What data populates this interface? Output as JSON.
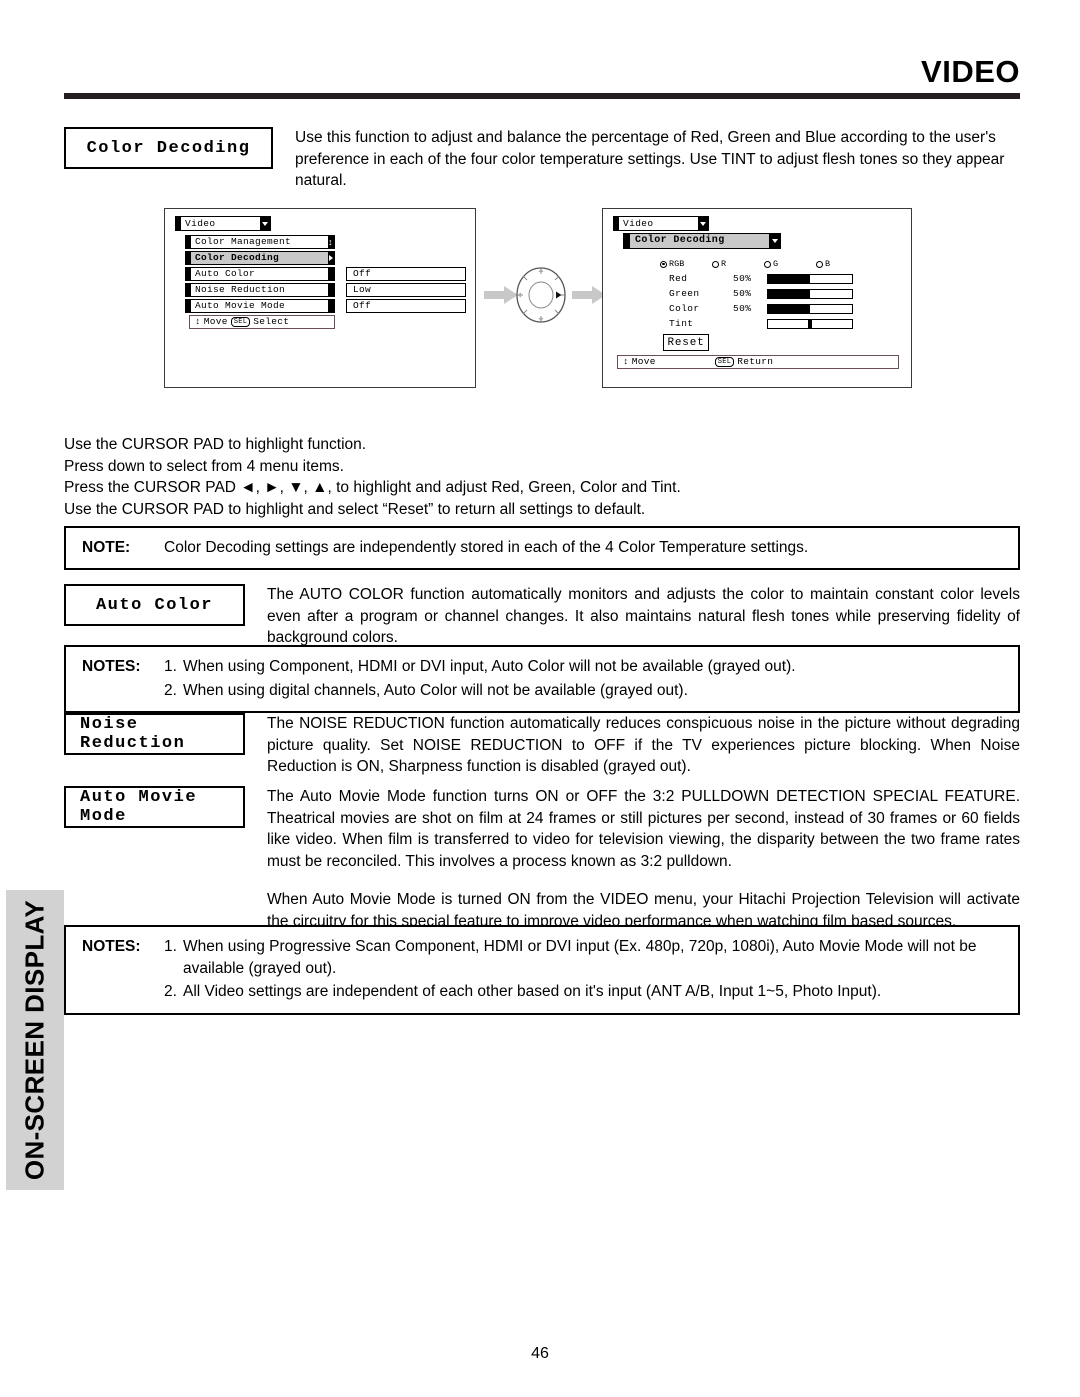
{
  "header": {
    "title": "VIDEO"
  },
  "side_tab": {
    "label": "ON-SCREEN DISPLAY"
  },
  "page_number": "46",
  "features": {
    "color_decoding": {
      "label": "Color Decoding",
      "text": "Use this function to adjust and balance the percentage of Red, Green and Blue according to the user's preference in each of the four color temperature settings.  Use TINT to adjust flesh tones so they appear natural."
    },
    "auto_color": {
      "label": "Auto Color",
      "text": "The AUTO COLOR function automatically monitors and adjusts the color to maintain constant color levels even after a program or channel changes. It also maintains natural flesh tones while preserving fidelity of background colors."
    },
    "noise_reduction": {
      "label": "Noise Reduction",
      "text": "The NOISE REDUCTION function automatically reduces conspicuous noise in the picture without degrading picture quality.  Set NOISE REDUCTION to OFF if the TV experiences picture blocking.  When Noise Reduction is ON, Sharpness function is disabled (grayed out)."
    },
    "auto_movie_mode": {
      "label": "Auto Movie Mode",
      "text_p1": "The Auto Movie Mode function turns ON or OFF the 3:2 PULLDOWN DETECTION SPECIAL FEATURE. Theatrical movies are shot on film at 24 frames or still pictures per second, instead of 30 frames or 60 fields like video.  When film is transferred to video for television viewing, the disparity between the two frame rates must be reconciled.  This involves a process known as 3:2 pulldown.",
      "text_p2": "When Auto Movie Mode is turned ON from the VIDEO menu, your Hitachi Projection Television will activate the circuitry for this special feature to improve video performance when watching film based sources."
    }
  },
  "cursor_instructions": {
    "line1": "Use the CURSOR PAD to highlight function.",
    "line2": "Press down to select from 4 menu items.",
    "line3": "Press the CURSOR PAD ◄, ►, ▼, ▲, to highlight and adjust Red, Green, Color and Tint.",
    "line4": "Use the CURSOR PAD to highlight and select “Reset” to return all settings to default."
  },
  "notes": {
    "note_color_decoding": {
      "tag": "NOTE:",
      "text": "Color Decoding settings are independently stored in each of the 4 Color Temperature settings."
    },
    "notes_auto_color": {
      "tag": "NOTES:",
      "items": [
        {
          "num": "1.",
          "text": "When using Component, HDMI or DVI input, Auto Color will not be available (grayed out)."
        },
        {
          "num": "2.",
          "text": "When using digital channels, Auto Color will not be available (grayed out)."
        }
      ]
    },
    "notes_auto_movie": {
      "tag": "NOTES:",
      "items": [
        {
          "num": "1.",
          "text": "When using Progressive Scan Component, HDMI or DVI input (Ex. 480p, 720p, 1080i), Auto Movie Mode will not be available (grayed out)."
        },
        {
          "num": "2.",
          "text": "All Video settings are independent of each other based on it's input (ANT A/B, Input 1~5, Photo Input)."
        }
      ]
    }
  },
  "osd_left": {
    "title": "Video",
    "rows": [
      {
        "label": "Color Management",
        "value": "",
        "selected": false,
        "end": "updown"
      },
      {
        "label": "Color Decoding",
        "value": "",
        "selected": true,
        "end": "tri"
      },
      {
        "label": "Auto Color",
        "value": "Off",
        "selected": false,
        "end": "plain"
      },
      {
        "label": "Noise Reduction",
        "value": "Low",
        "selected": false,
        "end": "plain"
      },
      {
        "label": "Auto Movie Mode",
        "value": "Off",
        "selected": false,
        "end": "plain"
      }
    ],
    "hint_move": "Move",
    "hint_key": "SEL",
    "hint_action": "Select"
  },
  "osd_right": {
    "title": "Video",
    "submenu": "Color Decoding",
    "radios": [
      {
        "label": "RGB",
        "selected": true
      },
      {
        "label": "R",
        "selected": false
      },
      {
        "label": "G",
        "selected": false
      },
      {
        "label": "B",
        "selected": false
      }
    ],
    "sliders": [
      {
        "name": "Red",
        "value": "50%",
        "fill_pct": 50,
        "type": "fill"
      },
      {
        "name": "Green",
        "value": "50%",
        "fill_pct": 50,
        "type": "fill"
      },
      {
        "name": "Color",
        "value": "50%",
        "fill_pct": 50,
        "type": "fill"
      },
      {
        "name": "Tint",
        "value": "",
        "fill_pct": 50,
        "type": "knob"
      }
    ],
    "reset_label": "Reset",
    "hint_move": "Move",
    "hint_key": "SEL",
    "hint_action": "Return"
  }
}
